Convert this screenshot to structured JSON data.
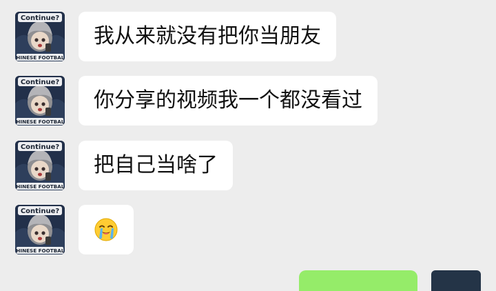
{
  "contact": {
    "avatar_caption_top": "Continue?",
    "avatar_caption_bottom": "CHINESE FOOTBALL"
  },
  "messages": [
    {
      "sender": "contact",
      "text": "我从来就没有把你当朋友"
    },
    {
      "sender": "contact",
      "text": "你分享的视频我一个都没看过"
    },
    {
      "sender": "contact",
      "text": "把自己当啥了"
    },
    {
      "sender": "contact",
      "emoji": "loudly-crying-face"
    }
  ],
  "colors": {
    "background": "#ededed",
    "incoming_bubble": "#ffffff",
    "outgoing_bubble": "#95ec69"
  }
}
